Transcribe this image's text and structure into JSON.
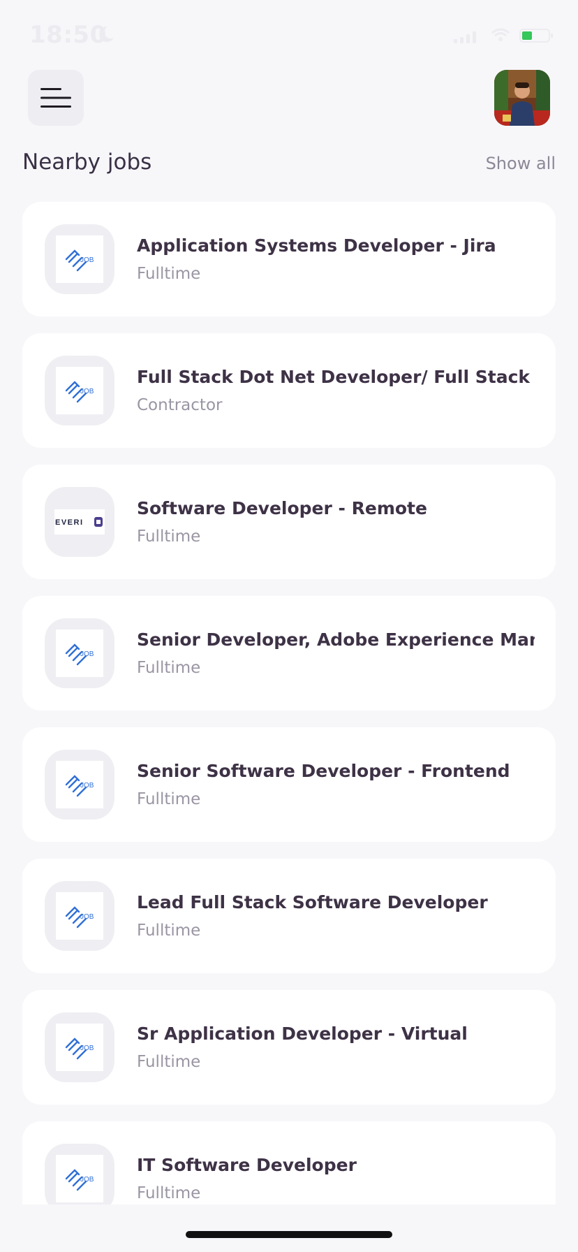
{
  "status_bar": {
    "time": "18:50"
  },
  "header": {
    "menu_icon": "hamburger-menu-icon",
    "avatar": "user-avatar-photo"
  },
  "section": {
    "title": "Nearby jobs",
    "show_all": "Show all"
  },
  "jobs": [
    {
      "title": "Application Systems Developer - Jira",
      "type": "Fulltime",
      "logo": "job-logo"
    },
    {
      "title": "Full Stack Dot Net Developer/ Full Stack ....",
      "type": "Contractor",
      "logo": "job-logo"
    },
    {
      "title": "Software Developer - Remote",
      "type": "Fulltime",
      "logo": "everi-logo",
      "logo_text": "EVERI"
    },
    {
      "title": "Senior Developer, Adobe Experience Man...",
      "type": "Fulltime",
      "logo": "job-logo"
    },
    {
      "title": "Senior Software Developer - Frontend",
      "type": "Fulltime",
      "logo": "job-logo"
    },
    {
      "title": "Lead Full Stack Software Developer",
      "type": "Fulltime",
      "logo": "job-logo"
    },
    {
      "title": "Sr Application Developer - Virtual",
      "type": "Fulltime",
      "logo": "job-logo"
    },
    {
      "title": "IT Software Developer",
      "type": "Fulltime",
      "logo": "job-logo"
    }
  ],
  "job_logo_text": "JOB",
  "colors": {
    "background": "#F7F7FA",
    "card": "#FFFFFF",
    "title": "#3E3246",
    "subtitle": "#9A95A3",
    "logo_blue": "#2F6FD6",
    "battery_green": "#34C759"
  }
}
